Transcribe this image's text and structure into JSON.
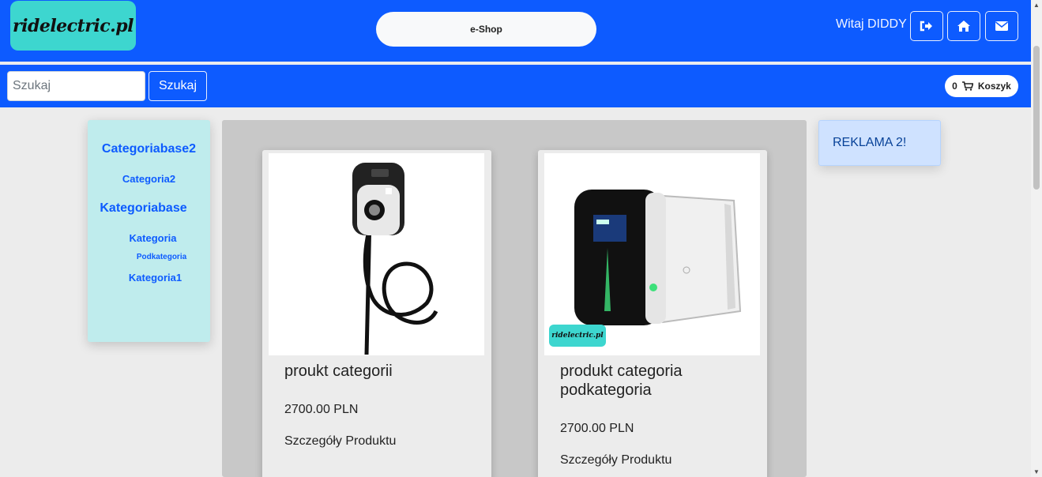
{
  "header": {
    "logo_text": "ridelectric.pl",
    "eshop_label": "e-Shop",
    "greeting": "Witaj DIDDY",
    "icons": [
      "sign-out-icon",
      "home-icon",
      "envelope-icon"
    ]
  },
  "search": {
    "placeholder": "Szukaj",
    "button_label": "Szukaj"
  },
  "cart": {
    "count": "0",
    "label": "Koszyk"
  },
  "sidebar": {
    "items": [
      {
        "label": "Categoriabase2"
      },
      {
        "label": "Categoria2"
      },
      {
        "label": "Kategoriabase"
      },
      {
        "label": "Kategoria"
      },
      {
        "label": "Podkategoria"
      },
      {
        "label": "Kategoria1"
      }
    ]
  },
  "products": [
    {
      "title": "proukt categorii",
      "price": "2700.00 PLN",
      "details": "Szczegóły Produktu"
    },
    {
      "title": "produkt categoria podkategoria",
      "price": "2700.00 PLN",
      "details": "Szczegóły Produktu",
      "badge": "ridelectric.pl"
    }
  ],
  "ad": {
    "text": "REKLAMA 2!"
  },
  "colors": {
    "primary": "#0d5bff",
    "logo": "#3dd6cf",
    "sidebar": "#bfeced"
  }
}
